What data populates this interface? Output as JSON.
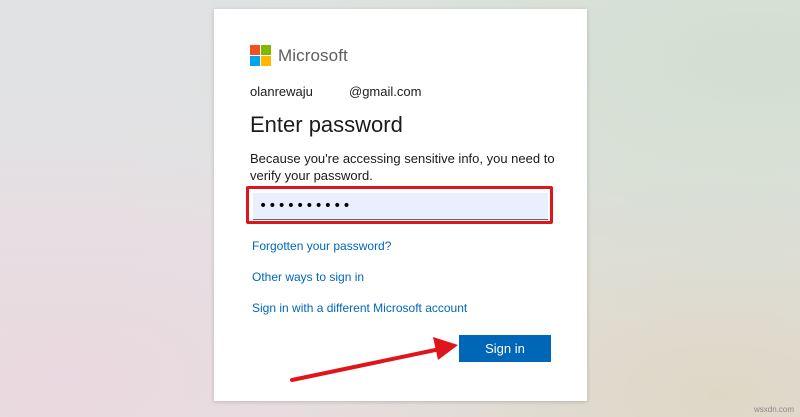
{
  "brand": {
    "name": "Microsoft",
    "logo_colors": [
      "#f25022",
      "#7fba00",
      "#00a4ef",
      "#ffb900"
    ]
  },
  "identity": {
    "username": "olanrewaju",
    "domain": "@gmail.com"
  },
  "page": {
    "title": "Enter password",
    "description": "Because you're accessing sensitive info, you need to verify your password."
  },
  "password_field": {
    "masked_value": "••••••••••",
    "highlight_color": "#e0141b",
    "fill_color": "#e8f0fe"
  },
  "links": {
    "forgot": "Forgotten your password?",
    "other_ways": "Other ways to sign in",
    "different_account": "Sign in with a different Microsoft account"
  },
  "actions": {
    "sign_in": "Sign in",
    "button_color": "#0067b8"
  },
  "annotation": {
    "arrow_color": "#e0141b"
  },
  "watermark": "wsxdn.com"
}
